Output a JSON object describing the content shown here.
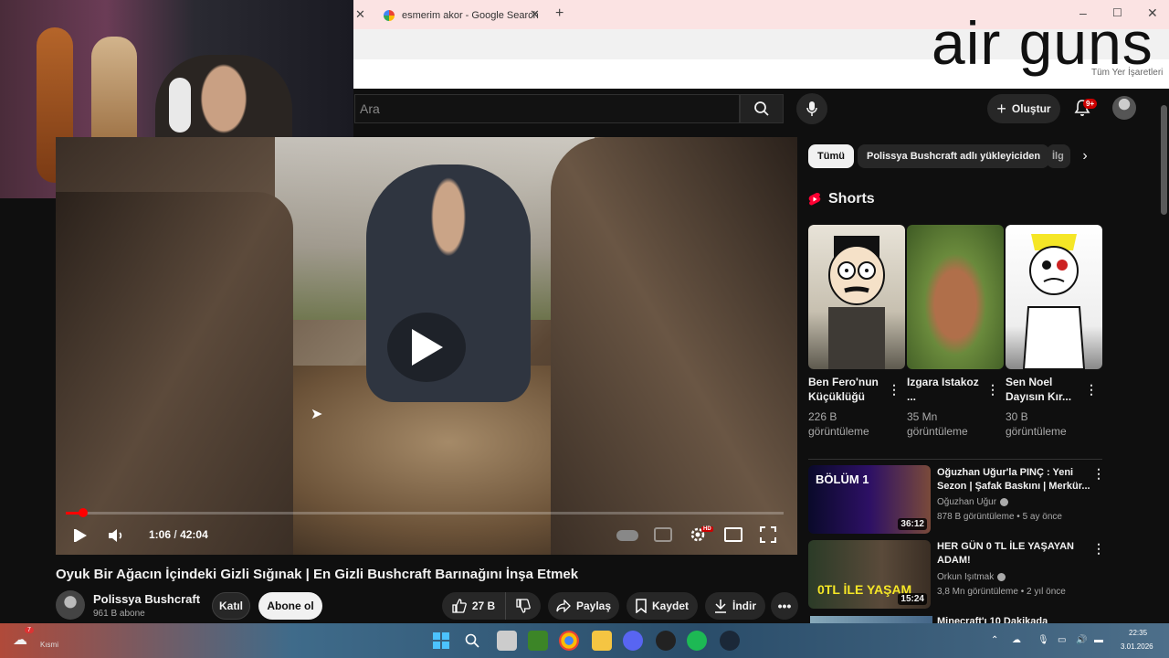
{
  "browser": {
    "tab_title": "esmerim akor - Google Search",
    "bookmarks_label": "Tüm Yer İşaretleri",
    "overlay_text": "air guns"
  },
  "header": {
    "search_placeholder": "Ara",
    "create_label": "Oluştur",
    "notification_count": "9+"
  },
  "player": {
    "current_time": "1:06",
    "separator": "/",
    "duration": "42:04",
    "progress": 0.026,
    "hd_label": "HD"
  },
  "video": {
    "title": "Oyuk Bir Ağacın İçindeki Gizli Sığınak | En Gizli Bushcraft Barınağını İnşa Etmek",
    "channel": "Polissya Bushcraft",
    "subscribers": "961 B abone",
    "join_label": "Katıl",
    "subscribe_label": "Abone ol",
    "likes": "27 B",
    "share_label": "Paylaş",
    "save_label": "Kaydet",
    "download_label": "İndir",
    "more_label": "•••"
  },
  "sidebar": {
    "chips": [
      "Tümü",
      "Polissya Bushcraft adlı yükleyiciden",
      "İlg"
    ],
    "shorts_title": "Shorts",
    "shorts": [
      {
        "title": "Ben Fero'nun Küçüklüğü",
        "views": "226 B görüntüleme"
      },
      {
        "title": "Izgara Istakoz ...",
        "views": "35 Mn görüntüleme"
      },
      {
        "title": "Sen Noel Dayısın Kır...",
        "views": "30 B görüntüleme"
      }
    ],
    "recommendations": [
      {
        "title": "Oğuzhan Uğur'la PINÇ : Yeni Sezon | Şafak Baskını | Merkür...",
        "channel": "Oğuzhan Uğur",
        "views": "878 B görüntüleme",
        "age": "5 ay önce",
        "duration": "36:12",
        "thumb_text": "BÖLÜM 1"
      },
      {
        "title": "HER GÜN 0 TL İLE YAŞAYAN ADAM!",
        "channel": "Orkun Işıtmak",
        "views": "3,8 Mn görüntüleme",
        "age": "2 yıl önce",
        "duration": "15:24",
        "thumb_text": "0TL İLE YAŞAM"
      },
      {
        "title": "Minecraft'ı 10 Dakikada"
      }
    ],
    "meta_separator": "•"
  },
  "taskbar": {
    "weather_badge": "7",
    "weather_label": "Kısmi",
    "clock_time": "22:35",
    "clock_date": "3.01.2026"
  }
}
